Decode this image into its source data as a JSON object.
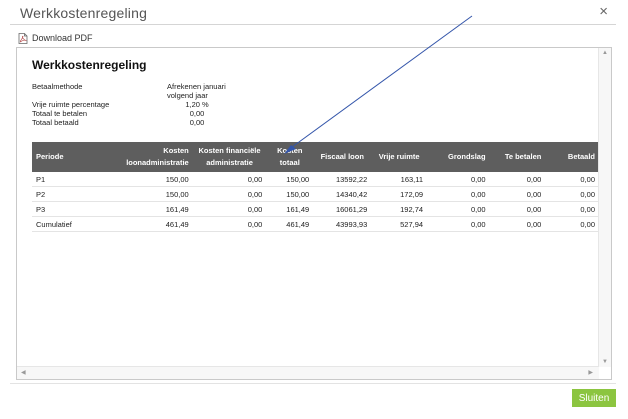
{
  "dialog": {
    "title": "Werkkostenregeling",
    "close_label": "×",
    "download_label": "Download PDF",
    "close_button_label": "Sluiten"
  },
  "report": {
    "title": "Werkkostenregeling",
    "meta": [
      {
        "label": "Betaalmethode",
        "value": "Afrekenen januari volgend jaar"
      },
      {
        "label": "Vrije ruimte percentage",
        "value": "1,20 %"
      },
      {
        "label": "Totaal te betalen",
        "value": "0,00"
      },
      {
        "label": "Totaal betaald",
        "value": "0,00"
      }
    ],
    "columns": [
      "Periode",
      "Kosten loonadministratie",
      "Kosten financiële administratie",
      "Kosten totaal",
      "Fiscaal loon",
      "Vrije ruimte",
      "Grondslag",
      "Te betalen",
      "Betaald"
    ],
    "rows": [
      [
        "P1",
        "150,00",
        "0,00",
        "150,00",
        "13592,22",
        "163,11",
        "0,00",
        "0,00",
        "0,00"
      ],
      [
        "P2",
        "150,00",
        "0,00",
        "150,00",
        "14340,42",
        "172,09",
        "0,00",
        "0,00",
        "0,00"
      ],
      [
        "P3",
        "161,49",
        "0,00",
        "161,49",
        "16061,29",
        "192,74",
        "0,00",
        "0,00",
        "0,00"
      ],
      [
        "Cumulatief",
        "461,49",
        "0,00",
        "461,49",
        "43993,93",
        "527,94",
        "0,00",
        "0,00",
        "0,00"
      ]
    ]
  },
  "colors": {
    "header_bg": "#5e5e5e",
    "accent_button": "#8cc540",
    "annotation_arrow": "#3355aa"
  },
  "icons": {
    "close": "close-icon",
    "download": "pdf-icon"
  }
}
